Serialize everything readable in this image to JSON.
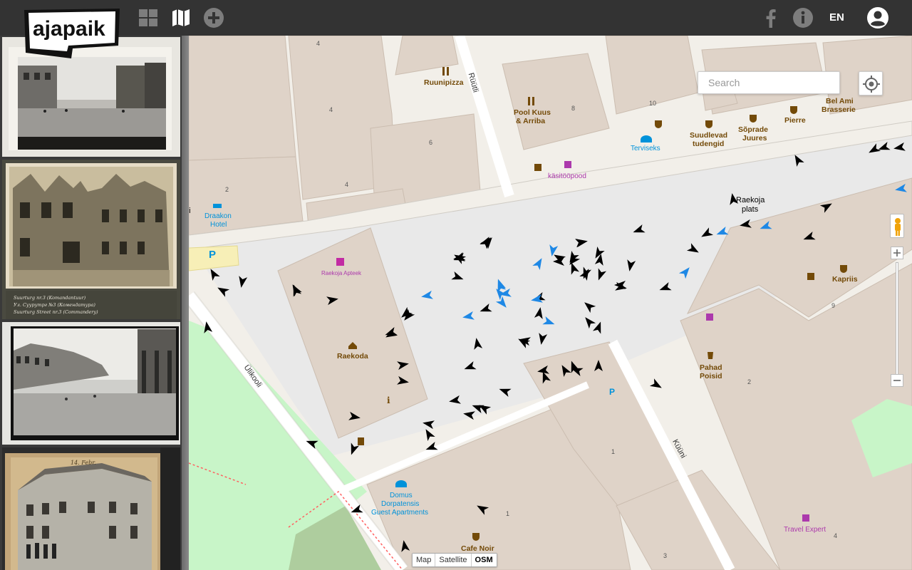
{
  "header": {
    "logo_text": "ajapaik",
    "language": "EN",
    "background": "#333333"
  },
  "icons": {
    "gallery": "grid-icon",
    "map": "map-icon",
    "add": "plus-circle-icon",
    "facebook": "facebook-icon",
    "info": "info-icon",
    "user": "user-icon"
  },
  "sidebar": {
    "photos": [
      {
        "kind": "street-square"
      },
      {
        "kind": "ruined-building",
        "captions": [
          "Suurturg nr.3 (Komandantuur)",
          "Ул. Суурутрг №3 (Комендатура)",
          "Suurturg Street nr.3 (Commandery)"
        ]
      },
      {
        "kind": "street-square"
      },
      {
        "kind": "corner-building",
        "note": "14. Febr."
      }
    ]
  },
  "map": {
    "search_placeholder": "Search",
    "labels": {
      "ruunipizza": "Ruunipizza",
      "pool_kuus_1": "Pool Kuus",
      "pool_kuus_2": "& Arriba",
      "suudlevad_1": "Suudlevad",
      "suudlevad_2": "tudengid",
      "soprade_1": "Sõprade",
      "soprade_2": "Juures",
      "pierre": "Pierre",
      "bel_ami_1": "Bel Ami",
      "bel_ami_2": "Brasserie",
      "terviseks": "Terviseks",
      "kasitoopood": "käsitööpood",
      "raekoja_plats_1": "Raekoja",
      "raekoja_plats_2": "plats",
      "draakon_1": "Draakon",
      "draakon_2": "Hotel",
      "raekoja_apteek": "Raekoja Apteek",
      "raekoda": "Raekoda",
      "kapriis": "Kapriis",
      "pahad_1": "Pahad",
      "pahad_2": "Poisid",
      "domus_1": "Domus",
      "domus_2": "Dorpatensis",
      "domus_3": "Guest Apartments",
      "cafe_noir": "Cafe Noir",
      "travel_expert": "Travel Expert",
      "street_ruutli": "Rüütli",
      "street_ulikooli": "Ülikooli",
      "street_kuuni": "Küüni",
      "cut_label": "ni",
      "parking": "P",
      "info_i": "i"
    },
    "house_numbers": [
      "4",
      "4",
      "6",
      "4",
      "2",
      "8",
      "10",
      "9",
      "2",
      "1",
      "1",
      "3",
      "4"
    ],
    "map_type": {
      "map": "Map",
      "satellite": "Satellite",
      "osm": "OSM",
      "selected": "OSM"
    },
    "colors": {
      "arrow_black": "#000000",
      "arrow_blue": "#1e88e5",
      "square": "#e8e8e8",
      "park": "#c8f5c8",
      "building": "#dfd3c8"
    }
  }
}
